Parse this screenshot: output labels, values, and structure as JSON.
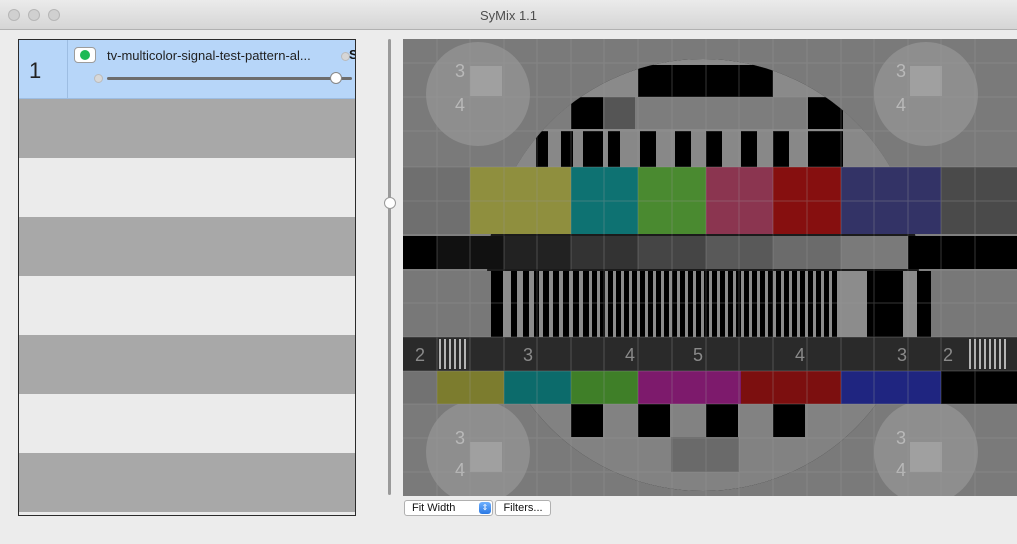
{
  "window": {
    "title": "SyMix 1.1"
  },
  "tracks": [
    {
      "number": "1",
      "name": "tv-multicolor-signal-test-pattern-al...",
      "solo_label": "S",
      "enabled": true,
      "volume": 1.0
    }
  ],
  "controls": {
    "zoom_value": "Fit Width",
    "filters_label": "Filters..."
  },
  "pattern_labels": {
    "scale_a": "2",
    "scale_b": "3",
    "scale_c": "4",
    "scale_d": "5",
    "corner_top": "3",
    "corner_bottom": "4"
  },
  "colors": {
    "selected_row": "#b7d6f9",
    "enabled_indicator": "#1db954",
    "accent": "#2a79e4"
  }
}
